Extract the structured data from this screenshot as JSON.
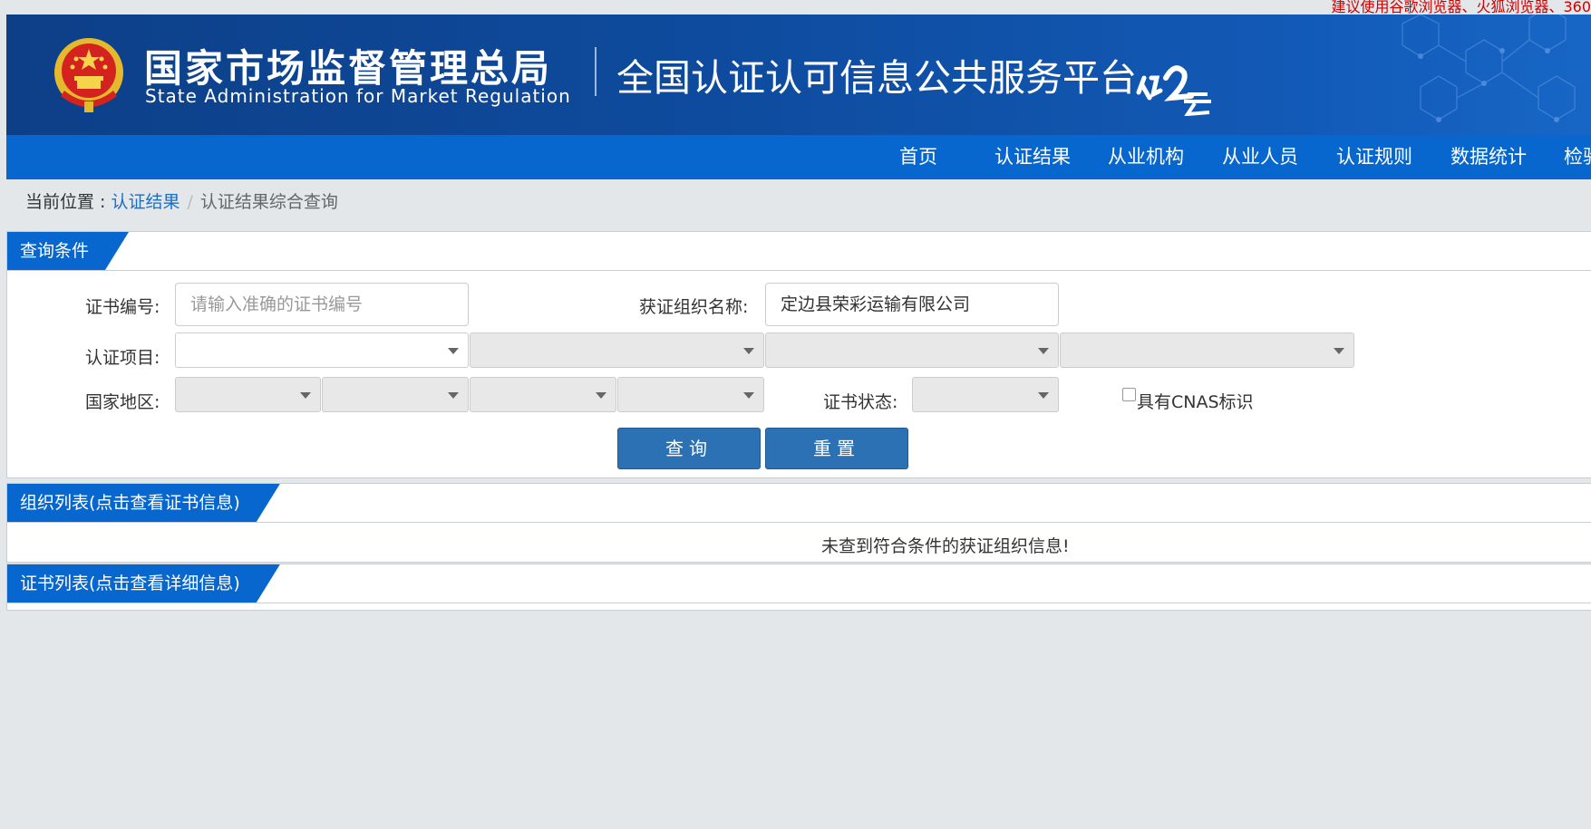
{
  "notice": "建议使用谷歌浏览器、火狐浏览器、360",
  "header": {
    "org_name_cn": "国家市场监督管理总局",
    "org_name_en": "State Administration  for  Market Regulation",
    "platform_title": "全国认证认可信息公共服务平台"
  },
  "nav": {
    "items": [
      {
        "label": "首页"
      },
      {
        "label": "认证结果"
      },
      {
        "label": "从业机构"
      },
      {
        "label": "从业人员"
      },
      {
        "label": "认证规则"
      },
      {
        "label": "数据统计"
      },
      {
        "label": "检验"
      }
    ]
  },
  "breadcrumb": {
    "prefix": "当前位置 : ",
    "link": "认证结果",
    "separator": "/",
    "current": "认证结果综合查询"
  },
  "query": {
    "title": "查询条件",
    "cert_no_label": "证书编号:",
    "cert_no_placeholder": "请输入准确的证书编号",
    "cert_no_value": "",
    "org_name_label": "获证组织名称:",
    "org_name_value": "定边县荣彩运输有限公司",
    "cert_project_label": "认证项目:",
    "region_label": "国家地区:",
    "cert_status_label": "证书状态:",
    "cnas_label": "具有CNAS标识",
    "cnas_checked": false,
    "search_button": "查询",
    "reset_button": "重置"
  },
  "org_list": {
    "title": "组织列表(点击查看证书信息)",
    "empty_message": "未查到符合条件的获证组织信息!"
  },
  "cert_list": {
    "title": "证书列表(点击查看详细信息)"
  },
  "colors": {
    "banner_blue": "#0e4b9e",
    "nav_blue": "#0867ce",
    "button_blue": "#2c71b3",
    "link_blue": "#1a6fc4",
    "notice_red": "#cc0000"
  }
}
